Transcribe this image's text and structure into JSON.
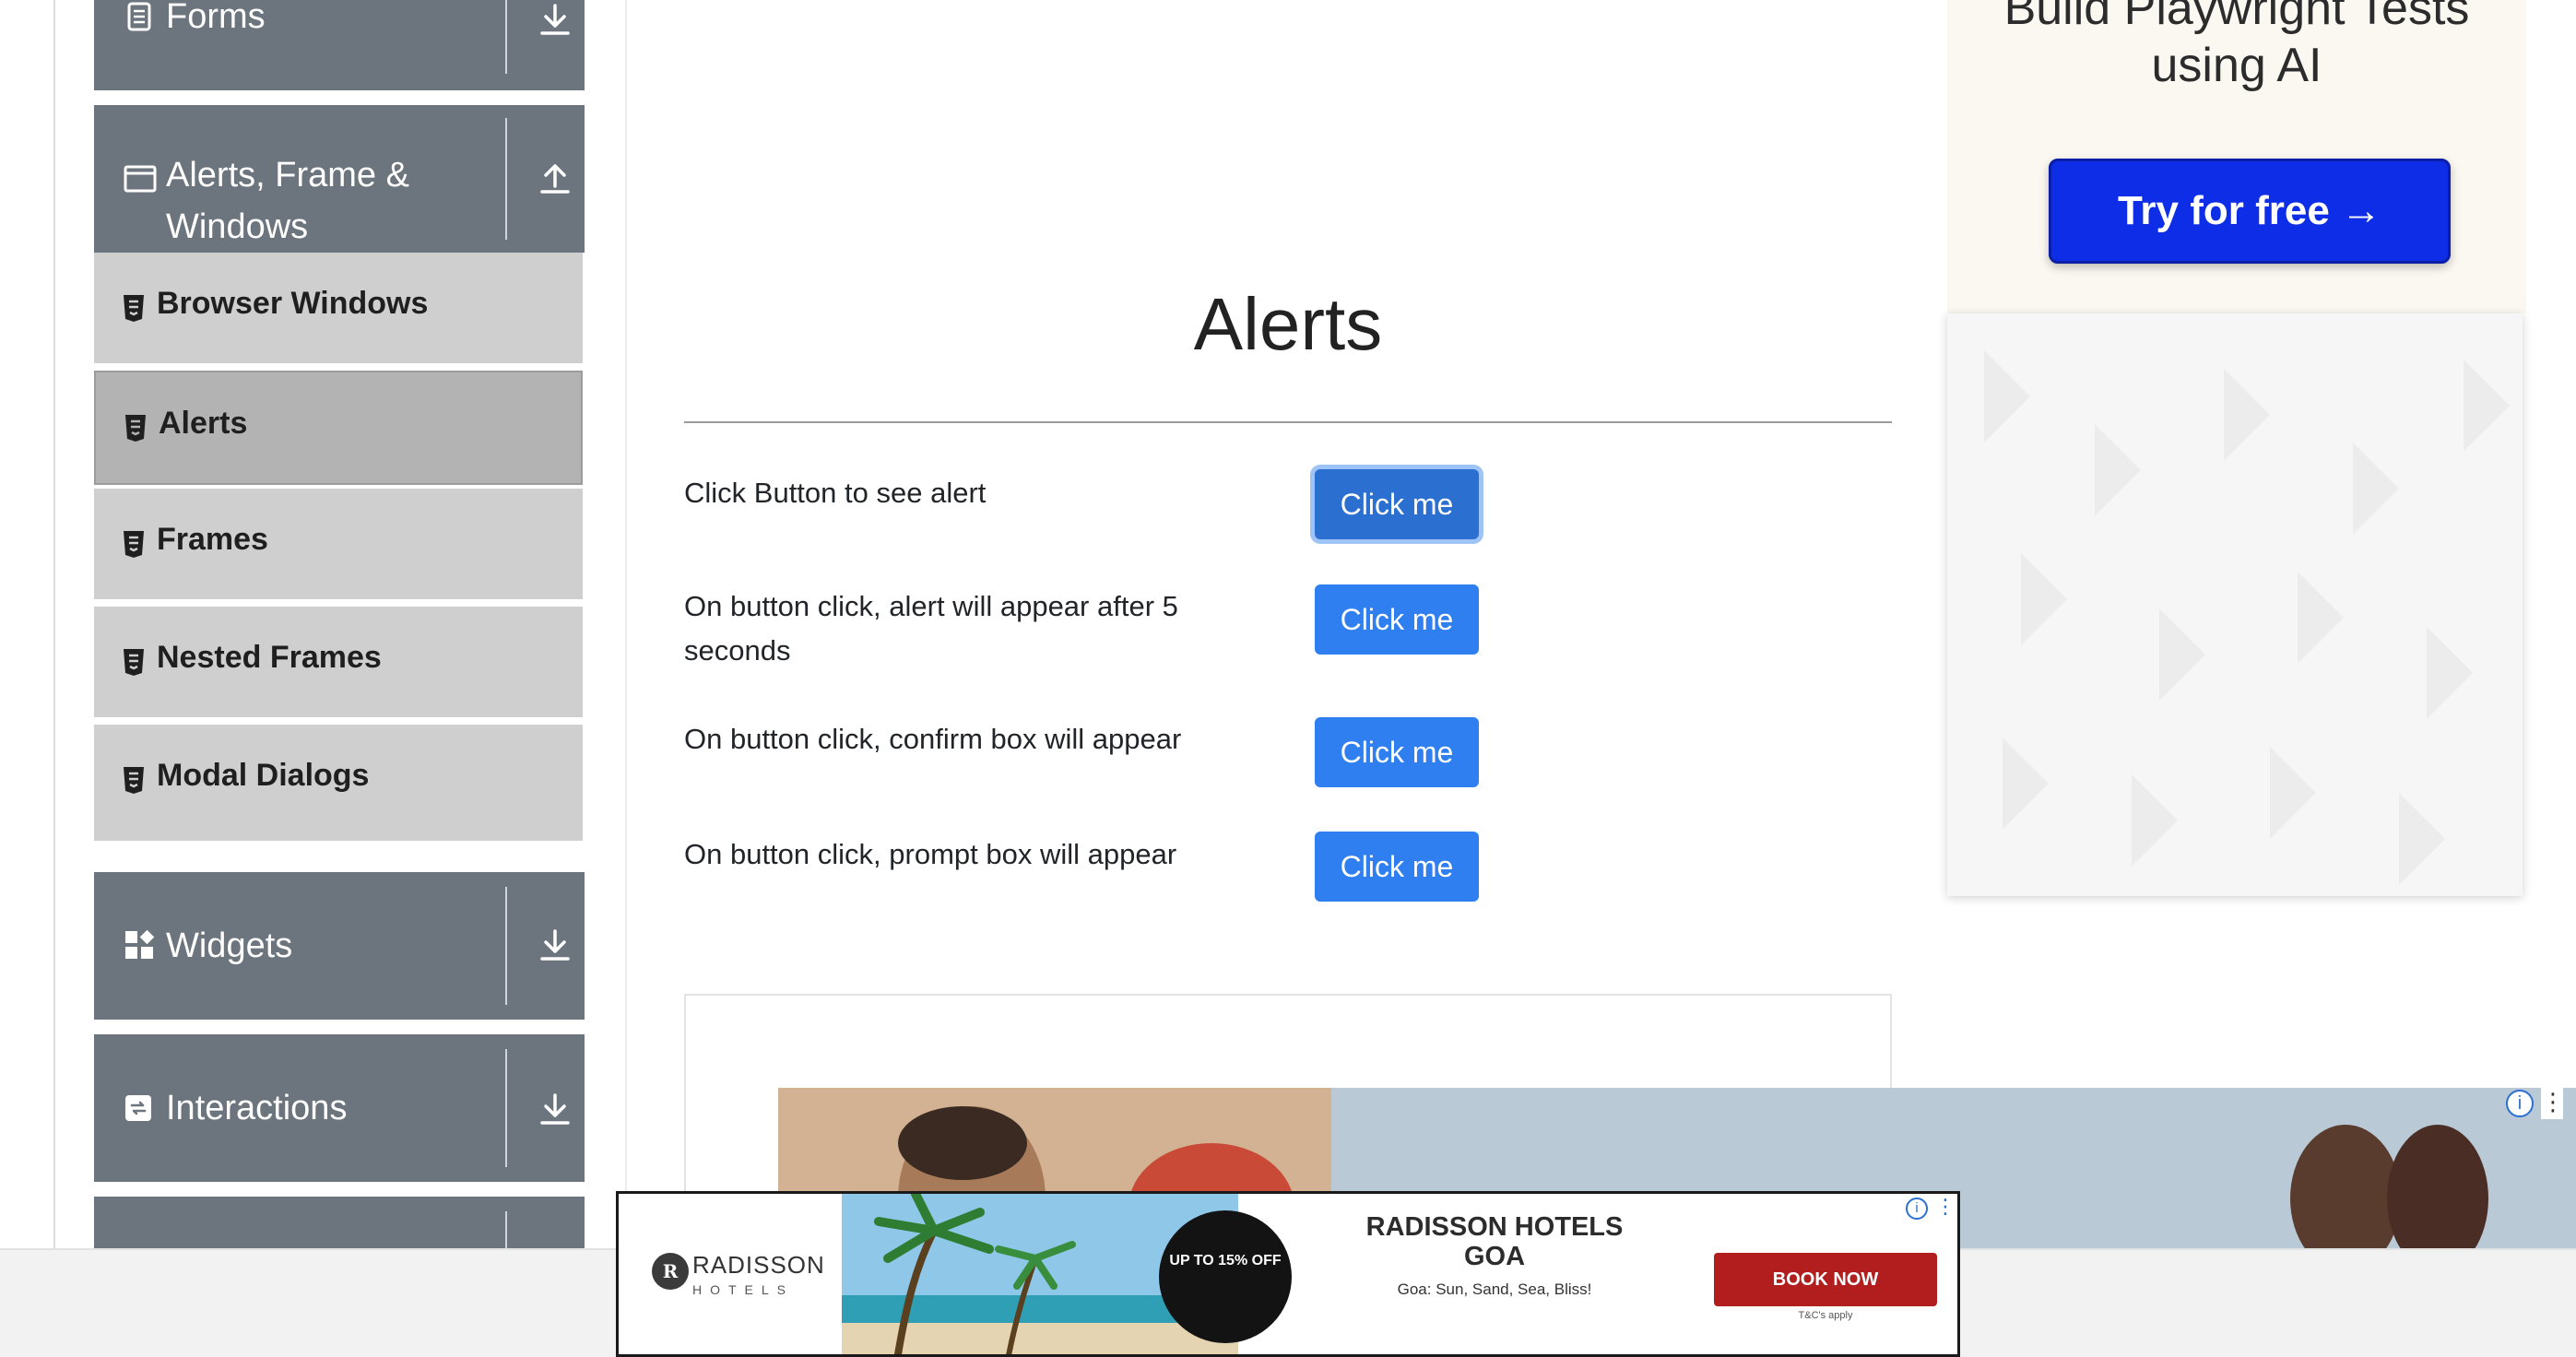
{
  "sidebar": {
    "groups": {
      "forms": {
        "label": "Forms",
        "icon": "document-icon",
        "arrow": "download-arrow-icon"
      },
      "alerts": {
        "label": "Alerts, Frame & Windows",
        "icon": "window-icon",
        "arrow": "upload-arrow-icon"
      },
      "widgets": {
        "label": "Widgets",
        "icon": "widgets-icon",
        "arrow": "download-arrow-icon"
      },
      "interactions": {
        "label": "Interactions",
        "icon": "interactions-icon",
        "arrow": "download-arrow-icon"
      }
    },
    "items": [
      {
        "label": "Browser Windows",
        "active": false
      },
      {
        "label": "Alerts",
        "active": true
      },
      {
        "label": "Frames",
        "active": false
      },
      {
        "label": "Nested Frames",
        "active": false
      },
      {
        "label": "Modal Dialogs",
        "active": false
      }
    ]
  },
  "main": {
    "title": "Alerts",
    "rows": [
      {
        "label": "Click Button to see alert",
        "button": "Click me"
      },
      {
        "label": "On button click, alert will appear after 5 seconds",
        "button": "Click me"
      },
      {
        "label": "On button click, confirm box will appear",
        "button": "Click me"
      },
      {
        "label": "On button click, prompt box will appear",
        "button": "Click me"
      }
    ]
  },
  "ad_right": {
    "headline": "Build Playwright Tests using AI",
    "cta": "Try for free →"
  },
  "sticky_ad": {
    "brand": "RADISSON",
    "brand_sub": "HOTELS",
    "badge": "UP TO 15% OFF",
    "title": "RADISSON HOTELS GOA",
    "subtitle": "Goa: Sun, Sand, Sea, Bliss!",
    "cta": "BOOK NOW",
    "terms": "T&C's apply"
  },
  "colors": {
    "sidebar_group": "#6c757d",
    "sidebar_item": "#cfcfcf",
    "sidebar_item_active": "#b3b3b3",
    "primary_button": "#2f7ff0",
    "ad_cta": "#0d2ee6",
    "book_now": "#b21e1e"
  }
}
